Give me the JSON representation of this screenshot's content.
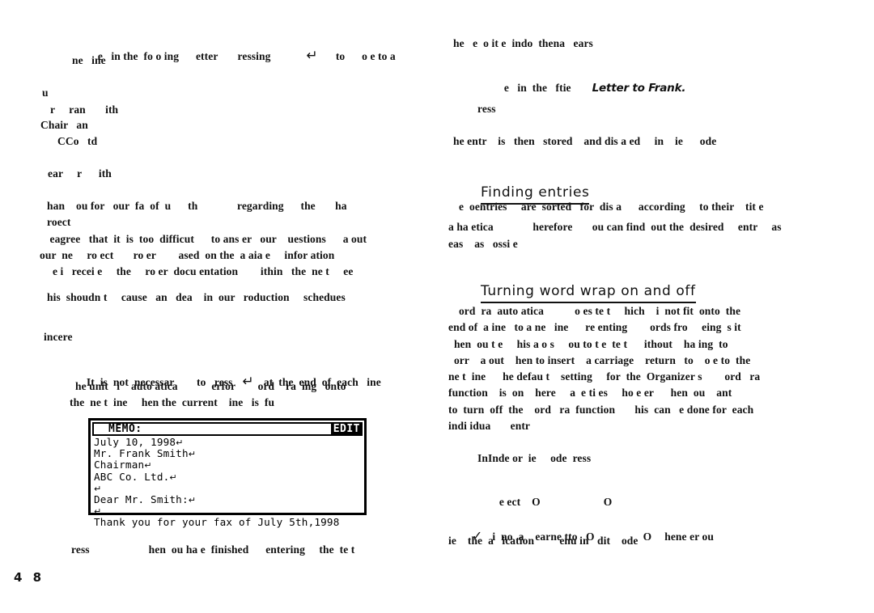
{
  "document": {
    "kind": "scanned-manual-page",
    "page_number": "4 8",
    "background_color": "#ffffff",
    "ink_color": "#111111"
  },
  "left_column": {
    "intro": {
      "line1": "e   in the  fo o ing      etter       ressing",
      "enter_glyph": "↵",
      "line1_tail": "to      o e to a",
      "line2": "ne   ine"
    },
    "address_block": [
      "u",
      "r     ran       ith",
      "Chair   an",
      "CCo   td"
    ],
    "salutation": "ear     r      ith",
    "body_para_1": [
      "han    ou for   our  fa  of  u      th              regarding      the       ha",
      "roect",
      " eagree   that  it  is  too  difficut      to ans er   our    uestions      a out",
      "our  ne     ro ect       ro er        ased  on the  a aia e     infor ation",
      "  e i   recei e     the     ro er  docu entation        ithin   the  ne t     ee"
    ],
    "body_para_2": "his  shoudn t     cause   an   dea    in  our   roduction     schedues",
    "closing": "incere",
    "note_block": [
      "It  is  not  necessar        to   ress",
      "he unit   i    auto atica            erfor        ord    ra  ing   onto",
      "the  ne t  ine     hen the  current    ine   is  fu"
    ],
    "note_enter_glyph": "↵",
    "note_tail": "at  the  end  of  each   ine",
    "caption_below_lcd": "ress                     hen  ou ha e  finished      entering     the  te t"
  },
  "lcd_screenshot": {
    "name": "memo-editor-lcd",
    "title": "MEMO:",
    "mode_label": "EDIT",
    "return_glyph": "↵",
    "lines": [
      {
        "text": "July 10, 1998",
        "return": true
      },
      {
        "text": "Mr. Frank Smith",
        "return": true
      },
      {
        "text": "Chairman",
        "return": true
      },
      {
        "text": "ABC Co. Ltd.",
        "return": true
      },
      {
        "text": "",
        "return": true
      },
      {
        "text": "Dear Mr. Smith:",
        "return": true
      },
      {
        "text": "",
        "return": true
      },
      {
        "text": "Thank you for your fax of July 5th,1998",
        "return": false
      }
    ]
  },
  "right_column": {
    "top_line": "he   e  o it e  indo  thena   ears",
    "title_line_prefix": "e   in  the   ftie",
    "title_line_italic": "Letter to Frank.",
    "press_line": "ress",
    "stored_line": "he entr    is   then   stored    and dis a ed     in    ie      ode",
    "heading_finding": "Finding entries",
    "finding_para": [
      "  e  oentries     are  sorted   for  dis a      according     to their    tit e",
      "a ha etica              herefore       ou can find  out the  desired     entr     as",
      "eas    as   ossi e"
    ],
    "heading_wordwrap": "Turning word wrap on and off",
    "wordwrap_para": [
      "  ord  ra  auto atica           o es te t     hich    i  not fit  onto  the",
      "end of  a ine   to a ne   ine      re enting        ords fro     eing  s it",
      "  hen  ou t e     his a o s     ou to t e  te t      ithout    ha ing  to",
      "  orr    a out    hen to insert    a carriage    return   to    o e to  the",
      "ne t  ine      he defau t    setting     for  the  Organizer s        ord   ra",
      "function    is  on    here     a  e ti es     ho e er      hen  ou    ant",
      "to  turn  off  the    ord   ra  function       his  can   e done for  each",
      "indi idua       entr"
    ],
    "index_line": "InInde or  ie     ode  ress",
    "select_line_a": "e ect    O",
    "select_line_b": "O",
    "check_glyph": "✓",
    "check_line_1a": "i  no  a    earne tto   O",
    "check_line_1b": "O",
    "check_line_1c": "hene er ou",
    "check_line_2": "ie    the  a   ication         enu in   dit    ode"
  }
}
